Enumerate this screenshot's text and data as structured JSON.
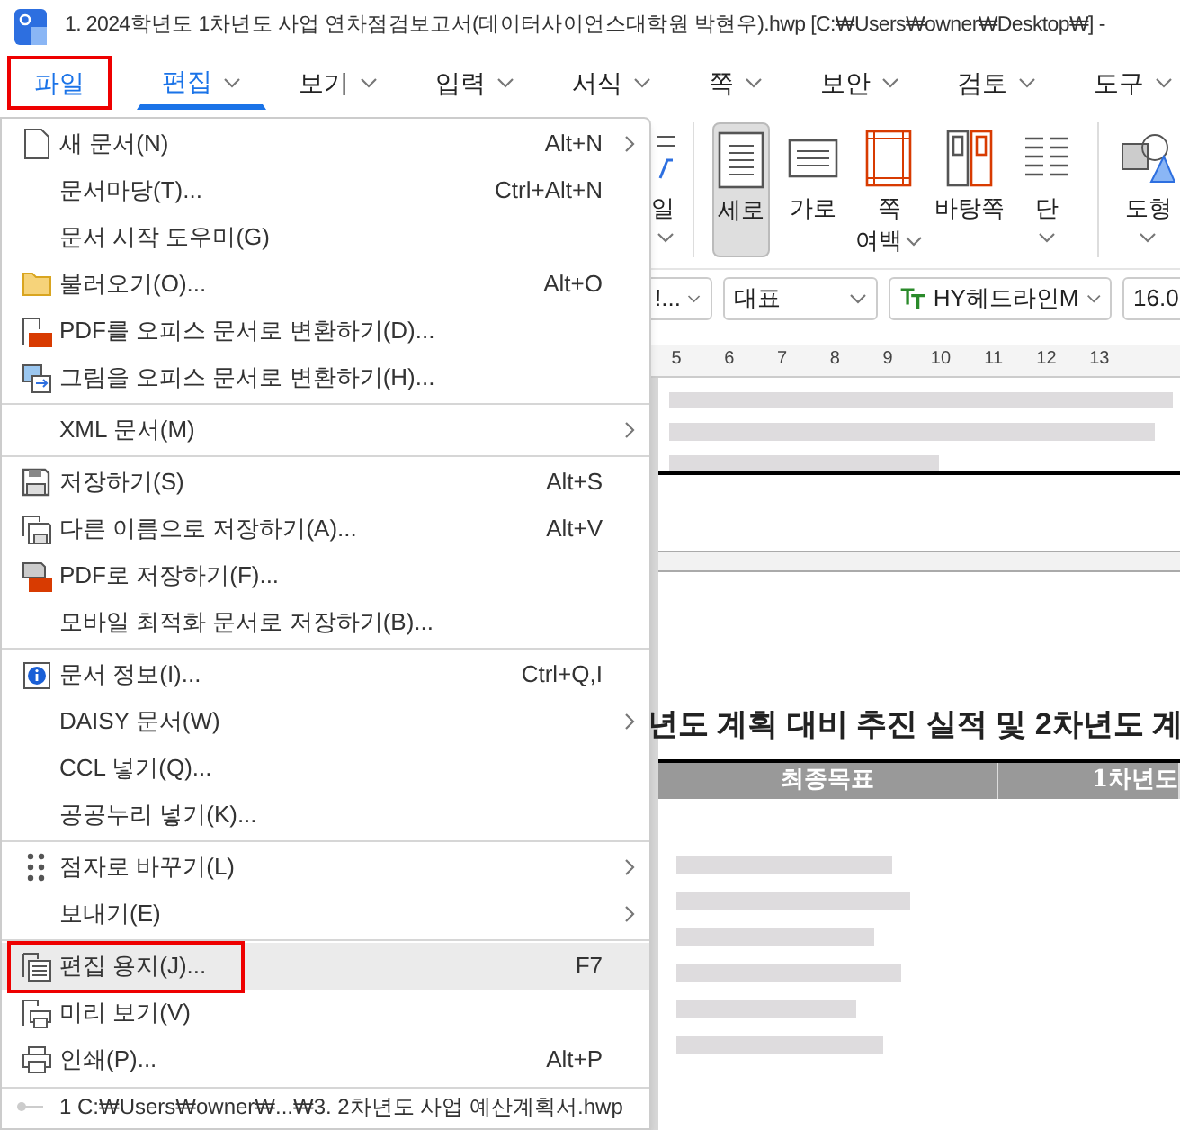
{
  "window": {
    "title": "1. 2024학년도 1차년도 사업 연차점검보고서(데이터사이언스대학원 박현우).hwp [C:₩Users₩owner₩Desktop₩] -"
  },
  "menu_tabs": [
    {
      "label": "파일",
      "selected": false,
      "dropdown": false,
      "annotated": true
    },
    {
      "label": "편집",
      "selected": true,
      "dropdown": true,
      "annotated": false
    },
    {
      "label": "보기",
      "selected": false,
      "dropdown": true,
      "annotated": false
    },
    {
      "label": "입력",
      "selected": false,
      "dropdown": true,
      "annotated": false
    },
    {
      "label": "서식",
      "selected": false,
      "dropdown": true,
      "annotated": false
    },
    {
      "label": "쪽",
      "selected": false,
      "dropdown": true,
      "annotated": false
    },
    {
      "label": "보안",
      "selected": false,
      "dropdown": true,
      "annotated": false
    },
    {
      "label": "검토",
      "selected": false,
      "dropdown": true,
      "annotated": false
    },
    {
      "label": "도구",
      "selected": false,
      "dropdown": true,
      "annotated": false
    }
  ],
  "file_menu": {
    "groups": [
      {
        "items": [
          {
            "kind": "page",
            "label": "새 문서(N)",
            "shortcut": "Alt+N",
            "submenu": true,
            "highlighted": false,
            "annotated": false
          },
          {
            "kind": "plain",
            "label": "문서마당(T)...",
            "shortcut": "Ctrl+Alt+N",
            "submenu": false,
            "highlighted": false,
            "annotated": false
          },
          {
            "kind": "plain",
            "label": "문서 시작 도우미(G)",
            "submenu": false,
            "highlighted": false,
            "annotated": false
          },
          {
            "kind": "folder",
            "label": "불러오기(O)...",
            "shortcut": "Alt+O",
            "submenu": false,
            "highlighted": false,
            "annotated": false
          },
          {
            "kind": "pdf",
            "label": "PDF를 오피스 문서로 변환하기(D)...",
            "submenu": false,
            "highlighted": false,
            "annotated": false
          },
          {
            "kind": "image",
            "label": "그림을 오피스 문서로 변환하기(H)...",
            "submenu": false,
            "highlighted": false,
            "annotated": false
          }
        ]
      },
      {
        "items": [
          {
            "kind": "plain",
            "label": "XML 문서(M)",
            "submenu": true,
            "highlighted": false,
            "annotated": false
          }
        ]
      },
      {
        "items": [
          {
            "kind": "save",
            "label": "저장하기(S)",
            "shortcut": "Alt+S",
            "submenu": false,
            "highlighted": false,
            "annotated": false
          },
          {
            "kind": "saveas",
            "label": "다른 이름으로 저장하기(A)...",
            "shortcut": "Alt+V",
            "submenu": false,
            "highlighted": false,
            "annotated": false
          },
          {
            "kind": "savepdf",
            "label": "PDF로 저장하기(F)...",
            "submenu": false,
            "highlighted": false,
            "annotated": false
          },
          {
            "kind": "plain",
            "label": "모바일 최적화 문서로 저장하기(B)...",
            "submenu": false,
            "highlighted": false,
            "annotated": false
          }
        ]
      },
      {
        "items": [
          {
            "kind": "info",
            "label": "문서 정보(I)...",
            "shortcut": "Ctrl+Q,I",
            "submenu": false,
            "highlighted": false,
            "annotated": false
          },
          {
            "kind": "plain",
            "label": "DAISY 문서(W)",
            "submenu": true,
            "highlighted": false,
            "annotated": false
          },
          {
            "kind": "plain",
            "label": "CCL 넣기(Q)...",
            "submenu": false,
            "highlighted": false,
            "annotated": false
          },
          {
            "kind": "plain",
            "label": "공공누리 넣기(K)...",
            "submenu": false,
            "highlighted": false,
            "annotated": false
          }
        ]
      },
      {
        "items": [
          {
            "kind": "braille",
            "label": "점자로 바꾸기(L)",
            "submenu": true,
            "highlighted": false,
            "annotated": false
          },
          {
            "kind": "plain",
            "label": "보내기(E)",
            "submenu": true,
            "highlighted": false,
            "annotated": false
          }
        ]
      },
      {
        "items": [
          {
            "kind": "pagesetup",
            "label": "편집 용지(J)...",
            "shortcut": "F7",
            "submenu": false,
            "highlighted": true,
            "annotated": true
          },
          {
            "kind": "preview",
            "label": "미리 보기(V)",
            "submenu": false,
            "highlighted": false,
            "annotated": false
          },
          {
            "kind": "print",
            "label": "인쇄(P)...",
            "shortcut": "Alt+P",
            "submenu": false,
            "highlighted": false,
            "annotated": false
          }
        ]
      }
    ],
    "recent": [
      {
        "label": "1 C:₩Users₩owner₩...₩3. 2차년도 사업 예산계획서.hwp"
      }
    ]
  },
  "ribbon": [
    {
      "kind": "style",
      "label": "일",
      "selected": false,
      "dropdown": true
    },
    {
      "kind": "portrait",
      "label": "세로",
      "selected": true,
      "dropdown": false
    },
    {
      "kind": "landscape",
      "label": "가로",
      "selected": false,
      "dropdown": false
    },
    {
      "kind": "margins",
      "label": "쪽",
      "label2": "여백",
      "selected": false,
      "dropdown": true
    },
    {
      "kind": "master",
      "label": "바탕쪽",
      "selected": false,
      "dropdown": false
    },
    {
      "kind": "columns",
      "label": "단",
      "selected": false,
      "dropdown": true
    },
    {
      "kind": "shapes",
      "label": "도형",
      "selected": false,
      "dropdown": true
    }
  ],
  "format_bar": [
    {
      "value": "!...",
      "font_icon": false
    },
    {
      "value": "대표",
      "font_icon": false
    },
    {
      "value": "HY헤드라인M",
      "font_icon": true
    },
    {
      "value": "16.0",
      "font_icon": false
    }
  ],
  "ruler": [
    "5",
    "6",
    "7",
    "8",
    "9",
    "10",
    "11",
    "12",
    "13"
  ],
  "document": {
    "heading": "년도 계획 대비 추진 실적 및 2차년도 계",
    "table_headers": [
      "최종목표",
      "1차년도"
    ]
  }
}
